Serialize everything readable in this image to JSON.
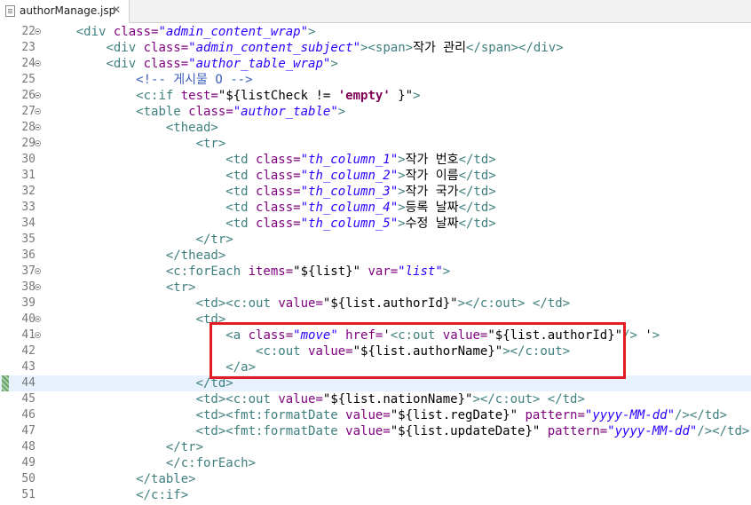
{
  "tab": {
    "filename": "authorManage.jsp",
    "close_glyph": "✕"
  },
  "editor": {
    "current_line": 44,
    "lines": [
      {
        "num": "22",
        "fold": true
      },
      {
        "num": "23",
        "fold": false
      },
      {
        "num": "24",
        "fold": true
      },
      {
        "num": "25",
        "fold": false
      },
      {
        "num": "26",
        "fold": true
      },
      {
        "num": "27",
        "fold": true
      },
      {
        "num": "28",
        "fold": true
      },
      {
        "num": "29",
        "fold": true
      },
      {
        "num": "30",
        "fold": false
      },
      {
        "num": "31",
        "fold": false
      },
      {
        "num": "32",
        "fold": false
      },
      {
        "num": "33",
        "fold": false
      },
      {
        "num": "34",
        "fold": false
      },
      {
        "num": "35",
        "fold": false
      },
      {
        "num": "36",
        "fold": false
      },
      {
        "num": "37",
        "fold": true
      },
      {
        "num": "38",
        "fold": true
      },
      {
        "num": "39",
        "fold": false
      },
      {
        "num": "40",
        "fold": true
      },
      {
        "num": "41",
        "fold": true
      },
      {
        "num": "42",
        "fold": false
      },
      {
        "num": "43",
        "fold": false
      },
      {
        "num": "44",
        "fold": false
      },
      {
        "num": "45",
        "fold": false
      },
      {
        "num": "46",
        "fold": false
      },
      {
        "num": "47",
        "fold": false
      },
      {
        "num": "48",
        "fold": false
      },
      {
        "num": "49",
        "fold": false
      },
      {
        "num": "50",
        "fold": false
      },
      {
        "num": "51",
        "fold": false
      }
    ],
    "code": [
      [
        [
          "",
          "    "
        ],
        [
          "t",
          "<div "
        ],
        [
          "a",
          "class="
        ],
        [
          "v",
          "\"admin_content_wrap\""
        ],
        [
          "t",
          ">"
        ]
      ],
      [
        [
          "",
          "        "
        ],
        [
          "t",
          "<div "
        ],
        [
          "a",
          "class="
        ],
        [
          "v",
          "\"admin_content_subject\""
        ],
        [
          "t",
          ">"
        ],
        [
          "t",
          "<span>"
        ],
        [
          "txt",
          "작가 관리"
        ],
        [
          "t",
          "</span>"
        ],
        [
          "t",
          "</div>"
        ]
      ],
      [
        [
          "",
          "        "
        ],
        [
          "t",
          "<div "
        ],
        [
          "a",
          "class="
        ],
        [
          "v",
          "\"author_table_wrap\""
        ],
        [
          "t",
          ">"
        ]
      ],
      [
        [
          "",
          "            "
        ],
        [
          "c",
          "<!-- 게시물 O -->"
        ]
      ],
      [
        [
          "",
          "            "
        ],
        [
          "t",
          "<c:if "
        ],
        [
          "a",
          "test="
        ],
        [
          "vn",
          "\"${listCheck != "
        ],
        [
          "k",
          "'empty'"
        ],
        [
          "vn",
          " }\""
        ],
        [
          "t",
          ">"
        ]
      ],
      [
        [
          "",
          "            "
        ],
        [
          "t",
          "<table "
        ],
        [
          "a",
          "class="
        ],
        [
          "v",
          "\"author_table\""
        ],
        [
          "t",
          ">"
        ]
      ],
      [
        [
          "",
          "                "
        ],
        [
          "t",
          "<thead>"
        ]
      ],
      [
        [
          "",
          "                    "
        ],
        [
          "t",
          "<tr>"
        ]
      ],
      [
        [
          "",
          "                        "
        ],
        [
          "t",
          "<td "
        ],
        [
          "a",
          "class="
        ],
        [
          "v",
          "\"th_column_1\""
        ],
        [
          "t",
          ">"
        ],
        [
          "txt",
          "작가 번호"
        ],
        [
          "t",
          "</td>"
        ]
      ],
      [
        [
          "",
          "                        "
        ],
        [
          "t",
          "<td "
        ],
        [
          "a",
          "class="
        ],
        [
          "v",
          "\"th_column_2\""
        ],
        [
          "t",
          ">"
        ],
        [
          "txt",
          "작가 이름"
        ],
        [
          "t",
          "</td>"
        ]
      ],
      [
        [
          "",
          "                        "
        ],
        [
          "t",
          "<td "
        ],
        [
          "a",
          "class="
        ],
        [
          "v",
          "\"th_column_3\""
        ],
        [
          "t",
          ">"
        ],
        [
          "txt",
          "작가 국가"
        ],
        [
          "t",
          "</td>"
        ]
      ],
      [
        [
          "",
          "                        "
        ],
        [
          "t",
          "<td "
        ],
        [
          "a",
          "class="
        ],
        [
          "v",
          "\"th_column_4\""
        ],
        [
          "t",
          ">"
        ],
        [
          "txt",
          "등록 날짜"
        ],
        [
          "t",
          "</td>"
        ]
      ],
      [
        [
          "",
          "                        "
        ],
        [
          "t",
          "<td "
        ],
        [
          "a",
          "class="
        ],
        [
          "v",
          "\"th_column_5\""
        ],
        [
          "t",
          ">"
        ],
        [
          "txt",
          "수정 날짜"
        ],
        [
          "t",
          "</td>"
        ]
      ],
      [
        [
          "",
          "                    "
        ],
        [
          "t",
          "</tr>"
        ]
      ],
      [
        [
          "",
          "                "
        ],
        [
          "t",
          "</thead>"
        ]
      ],
      [
        [
          "",
          "                "
        ],
        [
          "t",
          "<c:forEach "
        ],
        [
          "a",
          "items="
        ],
        [
          "vn",
          "\"${list}\""
        ],
        [
          "a",
          " var="
        ],
        [
          "v",
          "\"list\""
        ],
        [
          "t",
          ">"
        ]
      ],
      [
        [
          "",
          "                "
        ],
        [
          "t",
          "<tr>"
        ]
      ],
      [
        [
          "",
          "                    "
        ],
        [
          "t",
          "<td>"
        ],
        [
          "t",
          "<c:out "
        ],
        [
          "a",
          "value="
        ],
        [
          "vn",
          "\"${list.authorId}\""
        ],
        [
          "t",
          ">"
        ],
        [
          "t",
          "</c:out>"
        ],
        [
          "t",
          " </td>"
        ]
      ],
      [
        [
          "",
          "                    "
        ],
        [
          "t",
          "<td>"
        ]
      ],
      [
        [
          "",
          "                        "
        ],
        [
          "t",
          "<a "
        ],
        [
          "a",
          "class="
        ],
        [
          "v",
          "\"move\""
        ],
        [
          "a",
          " href="
        ],
        [
          "vn",
          "'"
        ],
        [
          "t",
          "<c:out "
        ],
        [
          "a",
          "value="
        ],
        [
          "vn",
          "\"${list.authorId}\""
        ],
        [
          "t",
          "/>"
        ],
        [
          "vn",
          " '"
        ],
        [
          "t",
          ">"
        ]
      ],
      [
        [
          "",
          "                            "
        ],
        [
          "t",
          "<c:out "
        ],
        [
          "a",
          "value="
        ],
        [
          "vn",
          "\"${list.authorName}\""
        ],
        [
          "t",
          ">"
        ],
        [
          "t",
          "</c:out>"
        ]
      ],
      [
        [
          "",
          "                        "
        ],
        [
          "t",
          "</a>"
        ]
      ],
      [
        [
          "",
          "                    "
        ],
        [
          "t",
          "</td>"
        ]
      ],
      [
        [
          "",
          "                    "
        ],
        [
          "t",
          "<td>"
        ],
        [
          "t",
          "<c:out "
        ],
        [
          "a",
          "value="
        ],
        [
          "vn",
          "\"${list.nationName}\""
        ],
        [
          "t",
          ">"
        ],
        [
          "t",
          "</c:out>"
        ],
        [
          "t",
          " </td>"
        ]
      ],
      [
        [
          "",
          "                    "
        ],
        [
          "t",
          "<td>"
        ],
        [
          "t",
          "<fmt:formatDate "
        ],
        [
          "a",
          "value="
        ],
        [
          "vn",
          "\"${list.regDate}\""
        ],
        [
          "a",
          " pattern="
        ],
        [
          "v",
          "\"yyyy-MM-dd\""
        ],
        [
          "t",
          "/>"
        ],
        [
          "t",
          "</td>"
        ]
      ],
      [
        [
          "",
          "                    "
        ],
        [
          "t",
          "<td>"
        ],
        [
          "t",
          "<fmt:formatDate "
        ],
        [
          "a",
          "value="
        ],
        [
          "vn",
          "\"${list.updateDate}\""
        ],
        [
          "a",
          " pattern="
        ],
        [
          "v",
          "\"yyyy-MM-dd\""
        ],
        [
          "t",
          "/>"
        ],
        [
          "t",
          "</td>"
        ]
      ],
      [
        [
          "",
          "                "
        ],
        [
          "t",
          "</tr>"
        ]
      ],
      [
        [
          "",
          "                "
        ],
        [
          "t",
          "</c:forEach>"
        ]
      ],
      [
        [
          "",
          "            "
        ],
        [
          "t",
          "</table>"
        ]
      ],
      [
        [
          "",
          "            "
        ],
        [
          "t",
          "</c:if>"
        ]
      ]
    ]
  }
}
